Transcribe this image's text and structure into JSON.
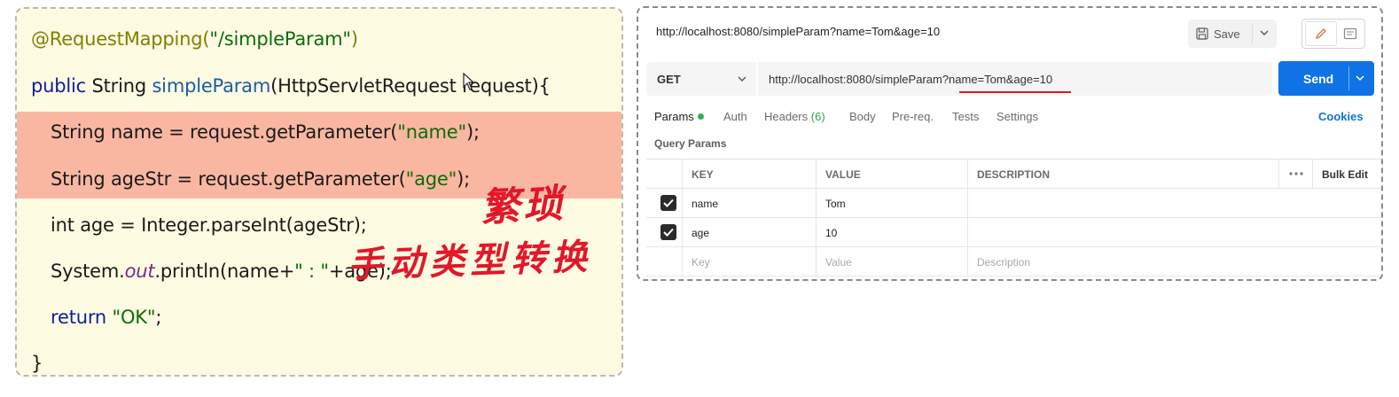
{
  "code": {
    "lines": [
      {
        "annotation": "@RequestMapping(",
        "string": "\"/simpleParam\"",
        "close": ")"
      },
      {
        "kw_public": "public",
        "type": " String ",
        "method": "simpleParam",
        "rest": "(HttpServletRequest request){"
      },
      {
        "pre": "String name = request.getParameter(",
        "string": "\"name\"",
        "post": ");"
      },
      {
        "pre": "String ageStr = request.getParameter(",
        "string": "\"age\"",
        "post": ");"
      },
      {
        "text": "int age = Integer.parseInt(ageStr);"
      },
      {
        "pre": "System.",
        "static": "out",
        "mid": ".println(name+",
        "string": "\" : \"",
        "post": "+age);"
      },
      {
        "kw": "return ",
        "string": "\"OK\"",
        "post": ";"
      },
      {
        "text": "}"
      }
    ],
    "handwritten_top": "繁琐",
    "handwritten_bottom": "手动类型转换"
  },
  "postman": {
    "tab_title": "http://localhost:8080/simpleParam?name=Tom&age=10",
    "save_label": "Save",
    "method": "GET",
    "url": "http://localhost:8080/simpleParam?name=Tom&age=10",
    "send_label": "Send",
    "tabs": {
      "params": "Params",
      "auth": "Auth",
      "headers": "Headers",
      "headers_count": "(6)",
      "body": "Body",
      "prereq": "Pre-req.",
      "tests": "Tests",
      "settings": "Settings"
    },
    "cookies_label": "Cookies",
    "query_params_title": "Query Params",
    "table": {
      "headers": {
        "key": "KEY",
        "value": "VALUE",
        "description": "DESCRIPTION",
        "bulk_edit": "Bulk Edit"
      },
      "rows": [
        {
          "checked": true,
          "key": "name",
          "value": "Tom",
          "description": ""
        },
        {
          "checked": true,
          "key": "age",
          "value": "10",
          "description": ""
        }
      ],
      "placeholder": {
        "key": "Key",
        "value": "Value",
        "description": "Description"
      }
    },
    "accent_color": "#0f72e5"
  }
}
